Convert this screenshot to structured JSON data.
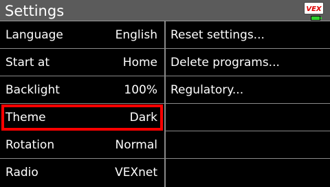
{
  "header": {
    "title": "Settings",
    "logo_text": "VEX"
  },
  "colors": {
    "header_bg": "#5b5b5b",
    "selection": "#ff0000",
    "battery": "#2fd12f"
  },
  "battery": {
    "level": 1.0
  },
  "settings": [
    {
      "label": "Language",
      "value": "English"
    },
    {
      "label": "Start at",
      "value": "Home"
    },
    {
      "label": "Backlight",
      "value": "100%"
    },
    {
      "label": "Theme",
      "value": "Dark"
    },
    {
      "label": "Rotation",
      "value": "Normal"
    },
    {
      "label": "Radio",
      "value": "VEXnet"
    }
  ],
  "actions": [
    {
      "label": "Reset settings..."
    },
    {
      "label": "Delete programs..."
    },
    {
      "label": "Regulatory..."
    },
    {
      "label": ""
    },
    {
      "label": ""
    },
    {
      "label": ""
    }
  ],
  "selected_setting": "Theme"
}
